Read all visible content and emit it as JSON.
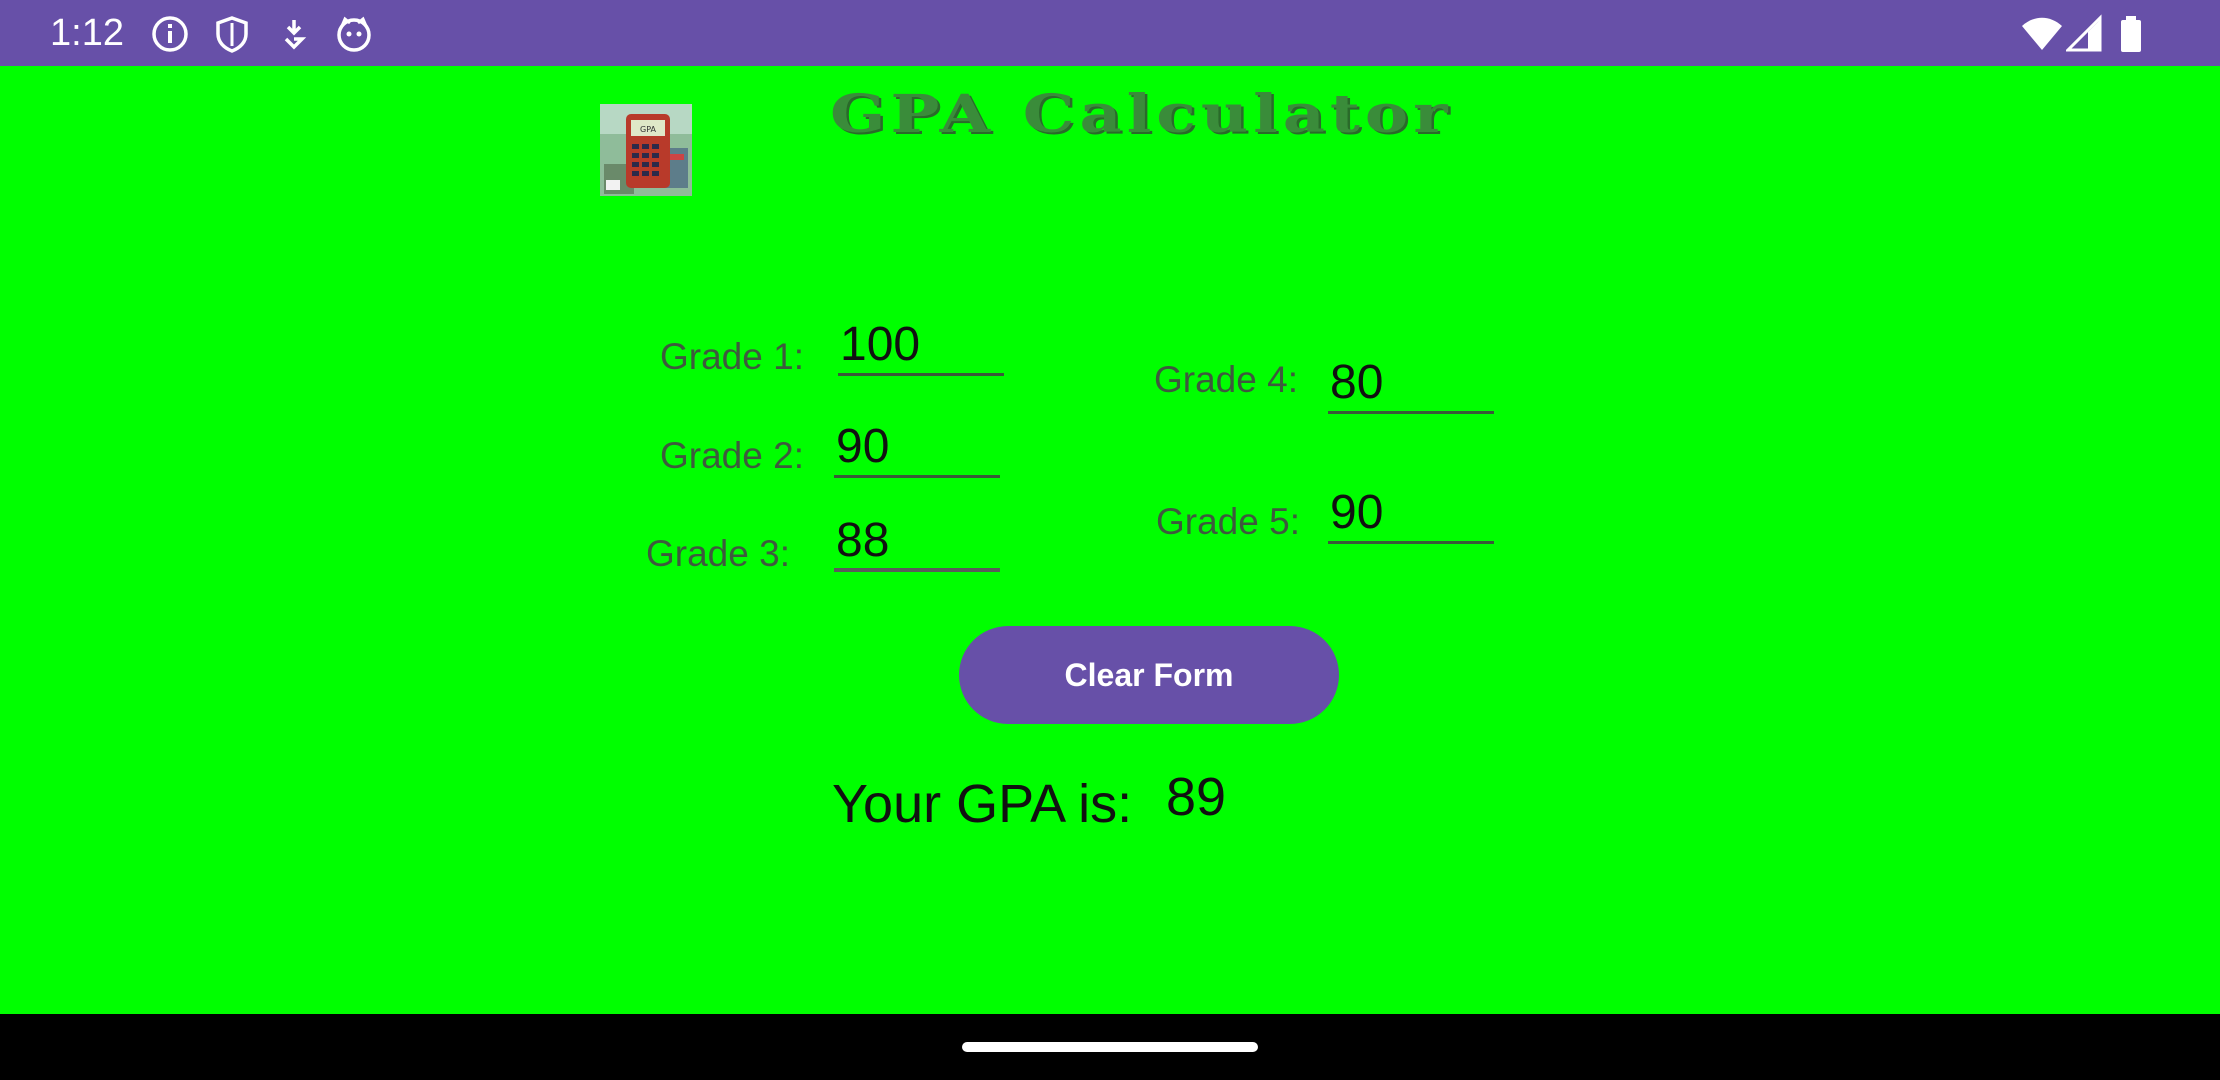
{
  "status_bar": {
    "time": "1:12",
    "left_icons": [
      "info-icon",
      "shield-icon",
      "download-icon",
      "cat-icon"
    ],
    "right_icons": [
      "wifi-icon",
      "signal-icon",
      "battery-icon"
    ],
    "background_color": "#6750a8"
  },
  "app": {
    "title": "GPA Calculator",
    "logo": "calculator-logo-icon",
    "background_color": "#00ff00"
  },
  "grades": [
    {
      "label": "Grade 1:",
      "value": "100"
    },
    {
      "label": "Grade 2:",
      "value": "90"
    },
    {
      "label": "Grade 3:",
      "value": "88"
    },
    {
      "label": "Grade 4:",
      "value": "80"
    },
    {
      "label": "Grade 5:",
      "value": "90"
    }
  ],
  "clear_button": {
    "label": "Clear Form",
    "color": "#6750a8"
  },
  "result": {
    "label": "Your GPA is:",
    "value": "89"
  }
}
